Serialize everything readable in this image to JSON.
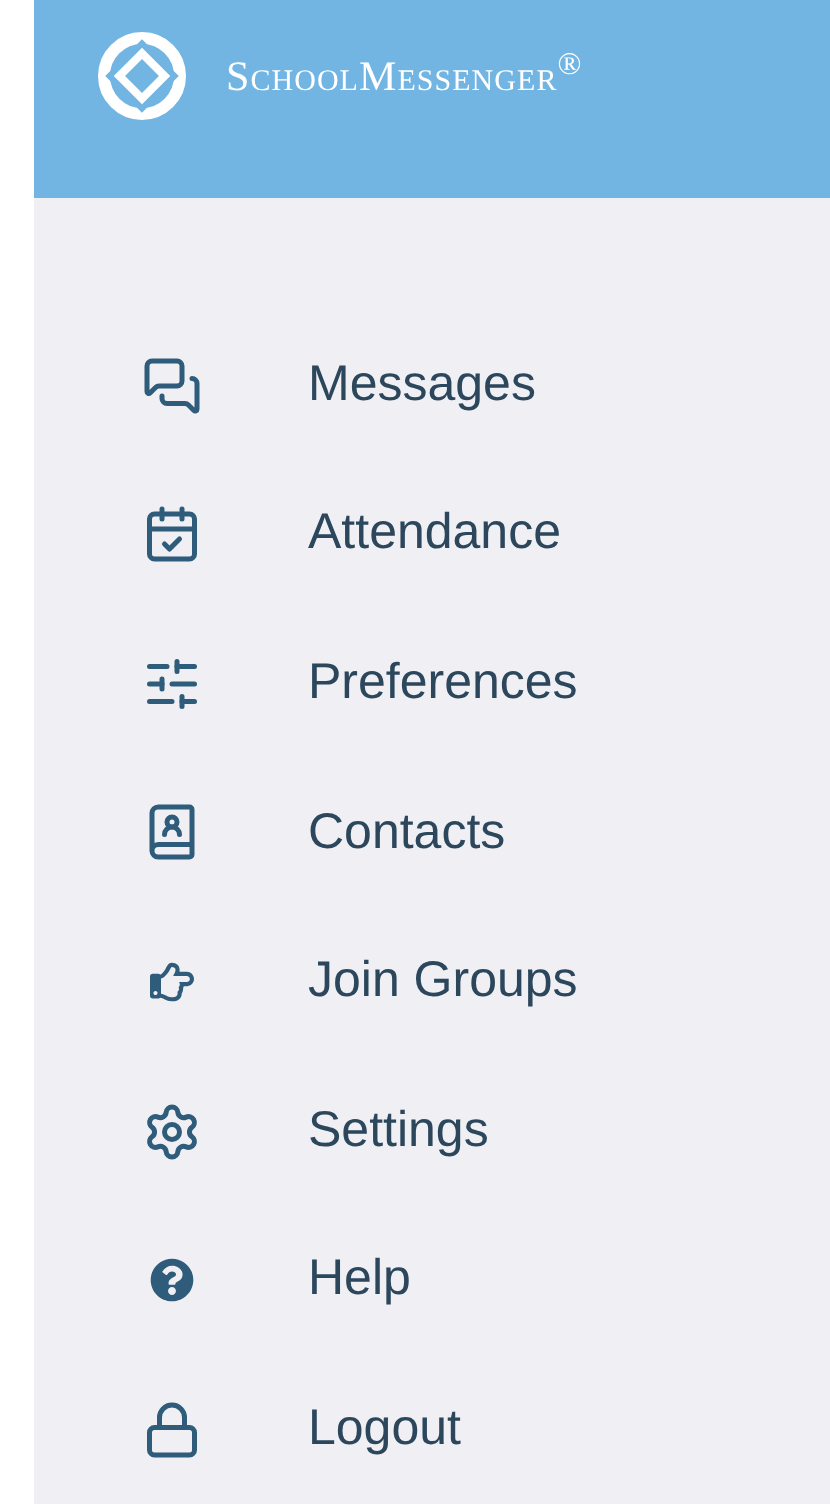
{
  "header": {
    "brand": "SchoolMessenger$^{®}$"
  },
  "menu": {
    "items": [
      {
        "label": "Messages"
      },
      {
        "label": "Attendance"
      },
      {
        "label": "Preferences"
      },
      {
        "label": "Contacts"
      },
      {
        "label": "Join Groups"
      },
      {
        "label": "Settings"
      },
      {
        "label": "Help"
      },
      {
        "label": "Logout"
      }
    ]
  }
}
